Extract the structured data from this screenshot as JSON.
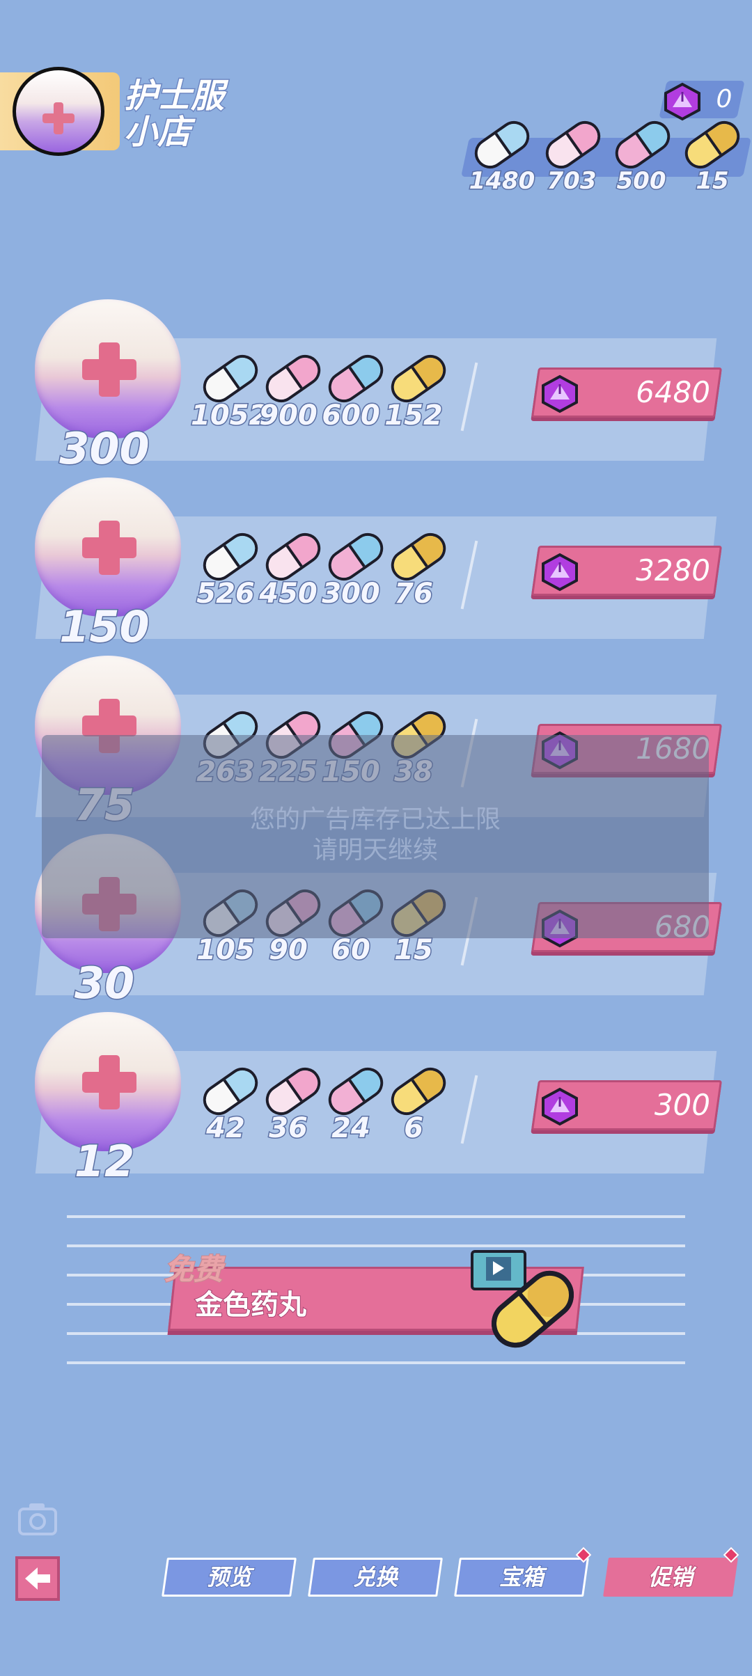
{
  "header": {
    "shop_title_line1": "护士服",
    "shop_title_line2": "小店",
    "gem_count": "0",
    "pill_counts": [
      "1480",
      "703",
      "500",
      "15"
    ]
  },
  "offers": [
    {
      "amount": "300",
      "pills": [
        "1052",
        "900",
        "600",
        "152"
      ],
      "price": "6480"
    },
    {
      "amount": "150",
      "pills": [
        "526",
        "450",
        "300",
        "76"
      ],
      "price": "3280"
    },
    {
      "amount": "75",
      "pills": [
        "263",
        "225",
        "150",
        "38"
      ],
      "price": "1680"
    },
    {
      "amount": "30",
      "pills": [
        "105",
        "90",
        "60",
        "15"
      ],
      "price": "680"
    },
    {
      "amount": "12",
      "pills": [
        "42",
        "36",
        "24",
        "6"
      ],
      "price": "300"
    }
  ],
  "toast": {
    "line1": "您的广告库存已达上限",
    "line2": "请明天继续"
  },
  "free_offer": {
    "tag": "免费",
    "label": "金色药丸"
  },
  "bottom_tabs": {
    "preview": "预览",
    "exchange": "兑换",
    "chest": "宝箱",
    "sale": "促销"
  },
  "colors": {
    "background": "#8fb0e0",
    "accent_pink": "#e46f99",
    "tab_blue": "#7b97e2",
    "gem_purple": "#b13de0"
  },
  "icons": {
    "currency": "gem-icon",
    "back": "back-arrow-icon",
    "camera": "camera-icon",
    "video": "video-ad-icon"
  }
}
